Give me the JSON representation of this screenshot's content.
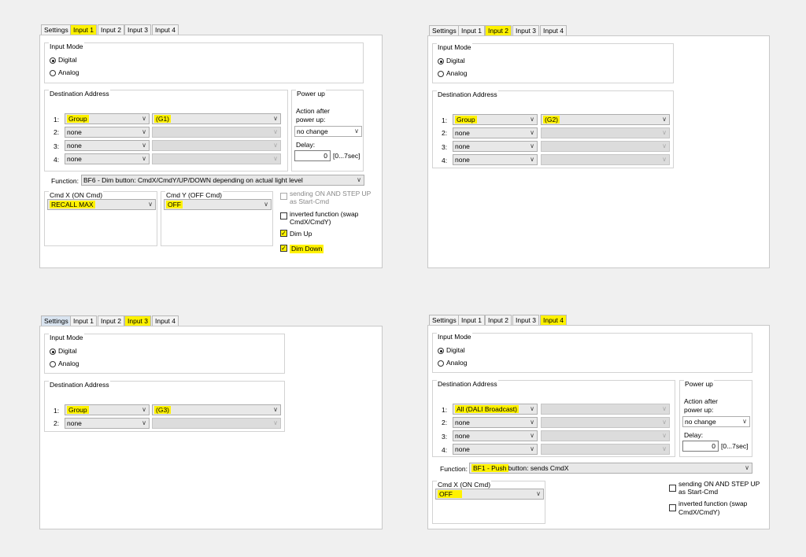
{
  "tabs": {
    "settings": "Settings",
    "input1": "Input 1",
    "input2": "Input 2",
    "input3": "Input 3",
    "input4": "Input 4"
  },
  "labels": {
    "input_mode": "Input Mode",
    "digital": "Digital",
    "analog": "Analog",
    "destination_address": "Destination Address",
    "power_up": "Power up",
    "action_after": "Action after",
    "power_up_colon": "power up:",
    "no_change": "no change",
    "delay": "Delay:",
    "delay_value": "0",
    "delay_range": "[0...7sec]",
    "function": "Function:",
    "cmd_x": "Cmd X  (ON Cmd)",
    "cmd_y": "Cmd Y  (OFF Cmd)",
    "sending_1": "sending ON AND STEP UP",
    "sending_2": "as Start-Cmd",
    "inverted_1": "inverted function (swap",
    "inverted_2": "CmdX/CmdY)",
    "dim_up": "Dim Up",
    "dim_down": "Dim Down",
    "row1": "1:",
    "row2": "2:",
    "row3": "3:",
    "row4": "4:",
    "none": "none",
    "group": "Group",
    "arrow": "∨"
  },
  "input1": {
    "dest1": "Group",
    "target1": "(G1)",
    "function": "BF6 - Dim button:  CmdX/CmdY/UP/DOWN depending on actual light level",
    "cmd_x": "RECALL MAX",
    "cmd_y": "OFF"
  },
  "input2": {
    "dest1": "Group",
    "target1": "(G2)"
  },
  "input3": {
    "dest1": "Group",
    "target1": "(G3)"
  },
  "input4": {
    "dest1": "All (DALI Broadcast)",
    "function_hl": "BF1 - Push",
    "function_rest": "button:  sends CmdX",
    "cmd_x": "OFF"
  }
}
